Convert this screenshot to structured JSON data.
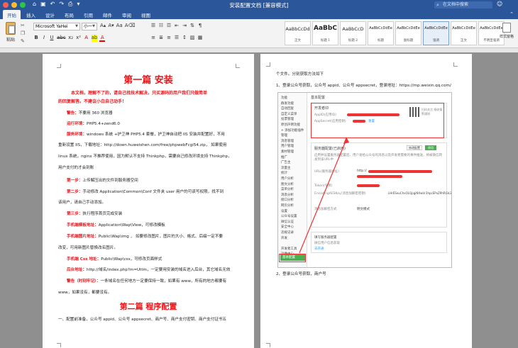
{
  "window": {
    "title": "安装配置文档 [兼容模式]",
    "search_placeholder": "在文档中搜索"
  },
  "tabs": [
    "开始",
    "插入",
    "设计",
    "布局",
    "引用",
    "邮件",
    "审阅",
    "视图"
  ],
  "ribbon": {
    "paste_label": "粘贴",
    "font_name": "Microsoft YaHei",
    "font_size": "小一",
    "styles": [
      {
        "preview": "AaBbCcDd",
        "name": "正文"
      },
      {
        "preview": "AaBbC",
        "name": "标题 1"
      },
      {
        "preview": "AaBbCcD",
        "name": "标题 2"
      },
      {
        "preview": "AaBbCcDdEe",
        "name": "标题"
      },
      {
        "preview": "AaBbCcDdEe",
        "name": "副标题"
      },
      {
        "preview": "AaBbCcDdEe",
        "name": "强调"
      },
      {
        "preview": "AaBbCcDdEe",
        "name": "正文"
      },
      {
        "preview": "AaBbCcDdEe",
        "name": "不明显强调"
      }
    ],
    "styles_pane_label": "样式窗格"
  },
  "page1": {
    "title1": "第一篇 安装",
    "intro_line1": "本文档，理解不了的，请自己找技术解决，只买源码的用户我们只做简单",
    "intro_line2": "的回复解答。不建议小白自己动手！",
    "warn_label": "警告：",
    "warn_text": "不要用 360 浏览器",
    "env_label": "运行环境：",
    "env_text": "PHP5.4+zend6.0",
    "server_label": "服务环境：",
    "server_text": "windows 系统 +护卫神 PHP5.4 套餐，护卫神自动把 IIS 安装并配置好，不用",
    "server_text2": "重新设置 IIS，下载地址：http://down.huweishen.com/free/phpwebFcgi54.zip， 如果使用",
    "server_text3": "linux 系统，nginx 不推荐使用，因为默认不支持 Thinkphp，需要自己修改环境支持 Thinkphp，",
    "server_text4": "用户支付的才会到账",
    "step1_label": "第一步：",
    "step1_text": "上传解压出的文件到服务器空间",
    "step2_label": "第二步：",
    "step2_text": "手动修改 Application\\Common\\Conf 文件夹 user 用户的可读写权限，找不到",
    "step2_text2": "该用户，请自己手动添加。",
    "step3_label": "第三步：",
    "step3_text": "执行程序首页完成安装",
    "tpl_label": "手机端模板地址：",
    "tpl_text": "Application\\Wap\\View，可修改模板",
    "img_label": "手机端图片地址：",
    "img_text": "Public\\Wap\\img ， 如要修改图片，图片的大小、格式、后缀一定不要",
    "img_text2": "改变，可用新图片替换改名图片。",
    "css_label": "手机端 Css 地址：",
    "css_text": "Public\\Wap\\css，可修改页面样式",
    "admin_label": "后台地址：",
    "admin_text": "http://域名/index.php?m=Uttm，一定要用安装的域名进入后台，其它域名无效",
    "note_label": "警告（时刻牢记）：",
    "note_text": "一条域名在任何地方一定要保持一致，如果有 www，所有的地方都要有",
    "note_text2": "www，如果没有，都要没有。",
    "title2": "第二篇 程序配置",
    "bottom_line": "一、配置前准备，公众号 appid、公众号 appsecret、商户号、商户支付密钥、商户支付证书五"
  },
  "page2": {
    "top_line": "个文件。分别获取方法如下",
    "item1": "1、登录公众号获取，公众号 appid、公众号 appsecret，登录地址：https://mp.weixin.qq.com/",
    "item2": "2、登录公众号获取，商户号",
    "shot": {
      "header": "基本配置",
      "side_items": [
        "功能",
        "群发功能",
        "自动回复",
        "自定义菜单",
        "投票管理",
        "原创声明功能",
        "+ 添加功能插件",
        "管理",
        "消息管理",
        "用户管理",
        "素材管理",
        "推广",
        "广告主",
        "流量主",
        "统计",
        "用户分析",
        "图文分析",
        "菜单分析",
        "消息分析",
        "接口分析",
        "网页分析",
        "设置",
        "公众号设置",
        "微信认证",
        "安全中心",
        "违规记录",
        "开发",
        "基本配置",
        "开发者工具",
        "运维中心",
        "接口权限"
      ],
      "selected_item": "基本配置",
      "dev_id_title": "开发者ID",
      "appid_label": "AppID(应用ID)",
      "appsecret_label": "AppSecret(应用密钥)",
      "reset_link": "重置",
      "qr_caption": "扫码关注 接收报警通知",
      "server_config_title": "服务器配置(已启用)",
      "server_desc": "启用并设置服务器配置后，用户发给公众号的消息以及开发者需要的事件推送，将被微信转发到该URL中",
      "modify_btn": "修改配置",
      "stop_btn": "停用",
      "url_label": "URL(服务器地址)",
      "url_value": "http://",
      "token_label": "Token(令牌)",
      "aes_label": "EncodingAESKey(消息加解密密钥)",
      "aes_value": "LHrESeuChxOLQpgiNXwUr3hpcEPxZ9hRGIc2bRD3dIy",
      "mode_label": "消息加解密方式",
      "mode_value": "明文模式",
      "reinstall_title": "填写服务器配置",
      "reinstall_desc": "微信用户信息获取",
      "reinstall_link": "去开通"
    }
  }
}
